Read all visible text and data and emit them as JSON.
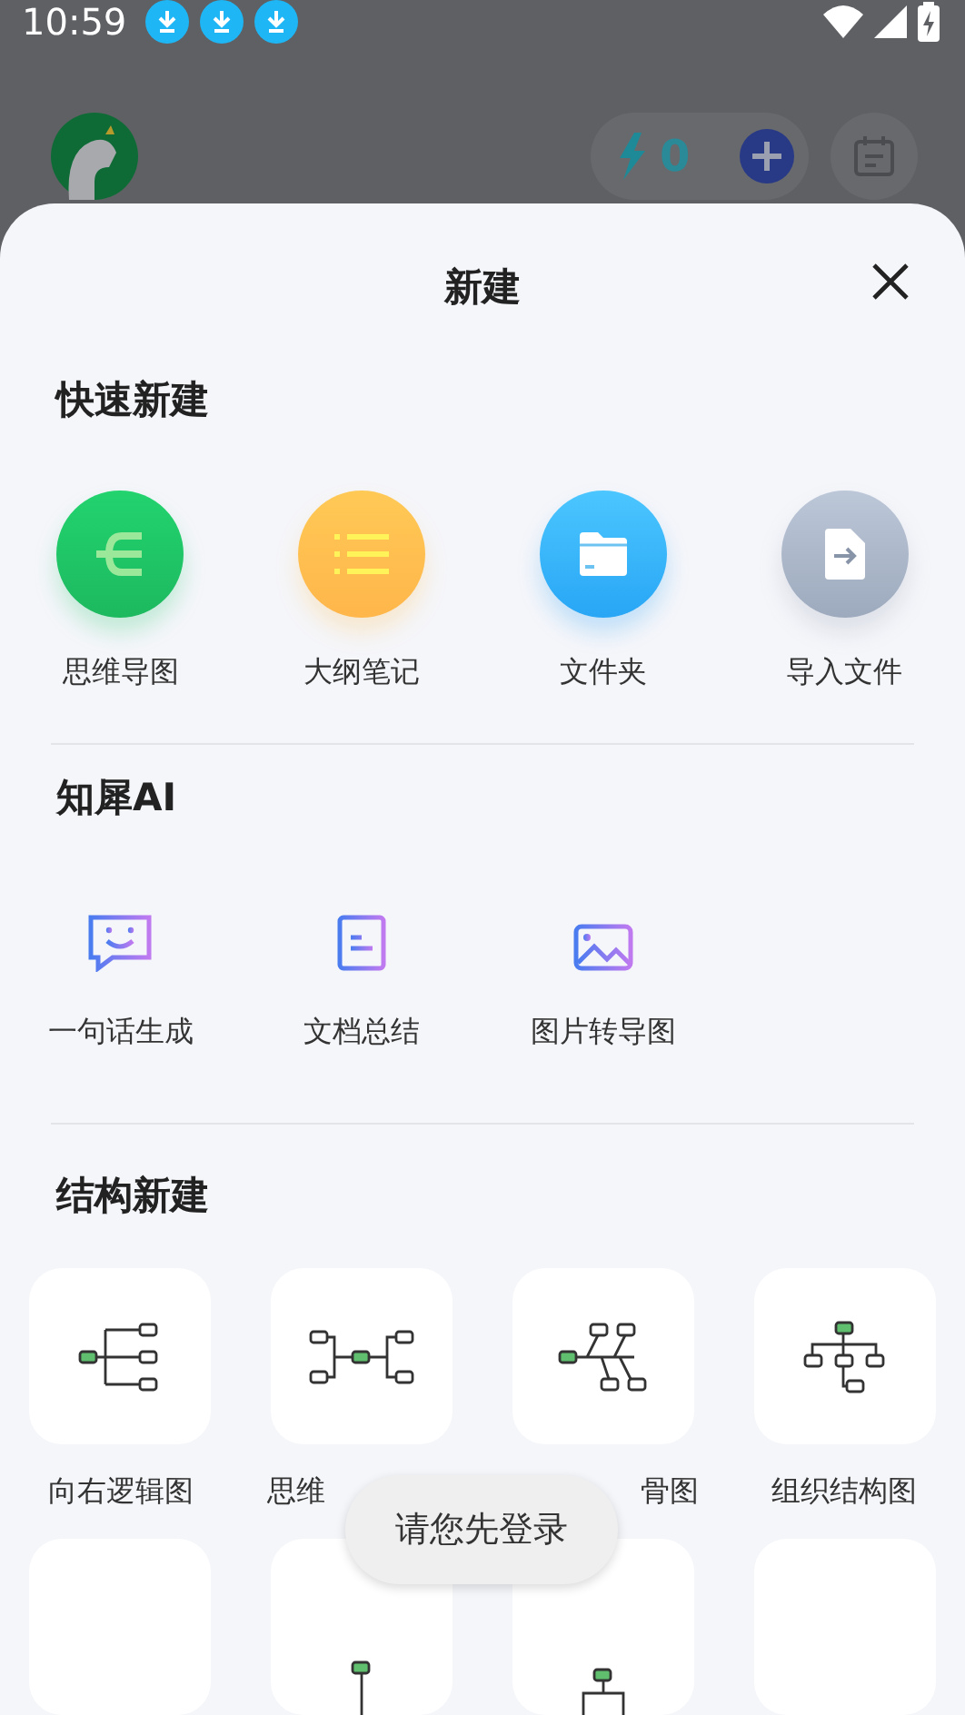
{
  "status_bar": {
    "time": "10:59",
    "notifications": [
      {
        "kind": "download"
      },
      {
        "kind": "download"
      },
      {
        "kind": "download"
      }
    ]
  },
  "header": {
    "points": "0"
  },
  "sheet": {
    "title": "新建",
    "quick": {
      "title": "快速新建",
      "items": [
        {
          "kind": "mindmap",
          "label": "思维导图"
        },
        {
          "kind": "outline",
          "label": "大纲笔记"
        },
        {
          "kind": "folder",
          "label": "文件夹"
        },
        {
          "kind": "import",
          "label": "导入文件"
        }
      ]
    },
    "ai": {
      "title": "知犀AI",
      "items": [
        {
          "kind": "chat",
          "label": "一句话生成"
        },
        {
          "kind": "doc",
          "label": "文档总结"
        },
        {
          "kind": "image",
          "label": "图片转导图"
        }
      ]
    },
    "structure": {
      "title": "结构新建",
      "items": [
        {
          "kind": "logic",
          "label": "向右逻辑图"
        },
        {
          "kind": "mind",
          "label": "思维"
        },
        {
          "kind": "fishbone",
          "label": "骨图"
        },
        {
          "kind": "org",
          "label": "组织结构图"
        },
        {
          "kind": "blank"
        },
        {
          "kind": "tree"
        },
        {
          "kind": "orgdown"
        },
        {
          "kind": "blank"
        }
      ]
    }
  },
  "toast": "请您先登录"
}
